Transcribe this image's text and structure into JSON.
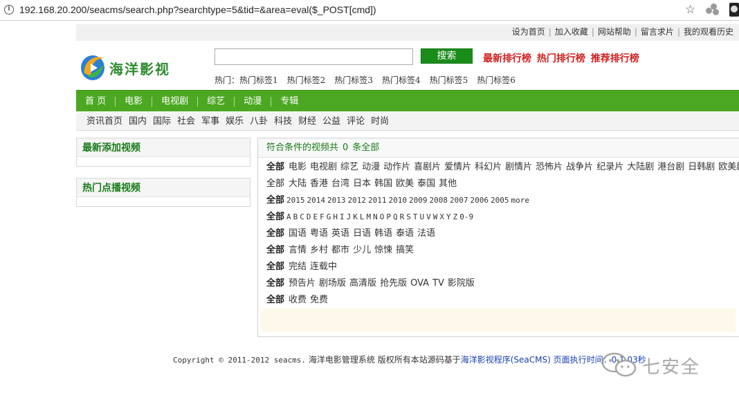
{
  "browser": {
    "url": "192.168.20.200/seacms/search.php?searchtype=5&tid=&area=eval($_POST[cmd])"
  },
  "toplinks": [
    "设为首页",
    "加入收藏",
    "网站帮助",
    "留言求片",
    "我的观看历史"
  ],
  "logo": {
    "text": "海洋影视"
  },
  "search": {
    "value": "",
    "button": "搜索"
  },
  "ranks": [
    "最新排行榜",
    "热门排行榜",
    "推荐排行榜"
  ],
  "hottags": {
    "label": "热门：",
    "tags": [
      "热门标签1",
      "热门标签2",
      "热门标签3",
      "热门标签4",
      "热门标签5",
      "热门标签6"
    ]
  },
  "mainnav": [
    "首 页",
    "电影",
    "电视剧",
    "综艺",
    "动漫",
    "专辑"
  ],
  "subnav": [
    "资讯首页",
    "国内",
    "国际",
    "社会",
    "军事",
    "娱乐",
    "八卦",
    "科技",
    "财经",
    "公益",
    "评论",
    "时尚"
  ],
  "sidebar": {
    "latest_title": "最新添加视频",
    "hot_title": "热门点播视频"
  },
  "results": {
    "prefix": "符合条件的视频共",
    "count": "0",
    "suffix": "条全部"
  },
  "filters": {
    "all_label": "全部",
    "type": [
      "电影",
      "电视剧",
      "综艺",
      "动漫",
      "动作片",
      "喜剧片",
      "爱情片",
      "科幻片",
      "剧情片",
      "恐怖片",
      "战争片",
      "纪录片",
      "大陆剧",
      "港台剧",
      "日韩剧",
      "欧美剧"
    ],
    "area": [
      "大陆",
      "香港",
      "台湾",
      "日本",
      "韩国",
      "欧美",
      "泰国",
      "其他"
    ],
    "year": [
      "2015",
      "2014",
      "2013",
      "2012",
      "2011",
      "2010",
      "2009",
      "2008",
      "2007",
      "2006",
      "2005"
    ],
    "year_more": "more",
    "letter": [
      "A",
      "B",
      "C",
      "D",
      "E",
      "F",
      "G",
      "H",
      "I",
      "J",
      "K",
      "L",
      "M",
      "N",
      "O",
      "P",
      "Q",
      "R",
      "S",
      "T",
      "U",
      "V",
      "W",
      "X",
      "Y",
      "Z",
      "0-9"
    ],
    "lang": [
      "国语",
      "粤语",
      "英语",
      "日语",
      "韩语",
      "泰语",
      "法语"
    ],
    "style": [
      "言情",
      "乡村",
      "都市",
      "少儿",
      "惊悚",
      "搞笑"
    ],
    "state": [
      "完结",
      "连载中"
    ],
    "version": [
      "预告片",
      "剧场版",
      "高清版",
      "抢先版",
      "OVA",
      "TV",
      "影院版"
    ],
    "money": [
      "收费",
      "免费"
    ]
  },
  "footer": {
    "copyright": "Copyright © 2011-2012 seacms.",
    "system": " 海洋电影管理系统 版权所有本站源码基于",
    "link": "海洋影视程序(SeaCMS)",
    "exec": " 页面执行时间：0.1.03秒"
  },
  "watermark": {
    "text": "七安全"
  },
  "colors": {
    "nav_green": "#4ca822",
    "title_green": "#1a7a1a",
    "rank_red": "#d21e1e",
    "link_blue": "#1a3fb0"
  }
}
